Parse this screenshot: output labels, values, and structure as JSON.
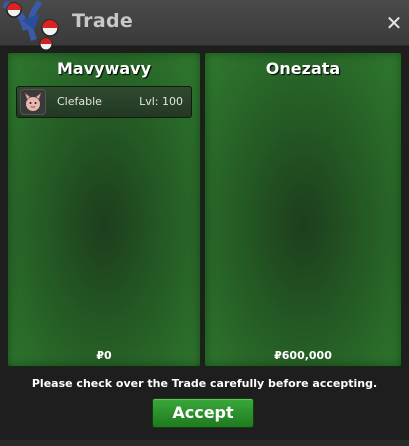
{
  "window": {
    "title": "Trade",
    "close_glyph": "✕"
  },
  "trade": {
    "left": {
      "player_name": "Mavywavy",
      "items": [
        {
          "name": "Clefable",
          "level": "Lvl: 100",
          "icon": "clefable-icon"
        }
      ],
      "money": "₽0"
    },
    "right": {
      "player_name": "Onezata",
      "items": [],
      "money": "₽600,000"
    }
  },
  "footer": {
    "notice": "Please check over the Trade carefully before accepting.",
    "accept_label": "Accept"
  },
  "colors": {
    "panel_green": "#2f7a2f",
    "accept_green": "#2f9a2f",
    "titlebar": "#404040"
  }
}
